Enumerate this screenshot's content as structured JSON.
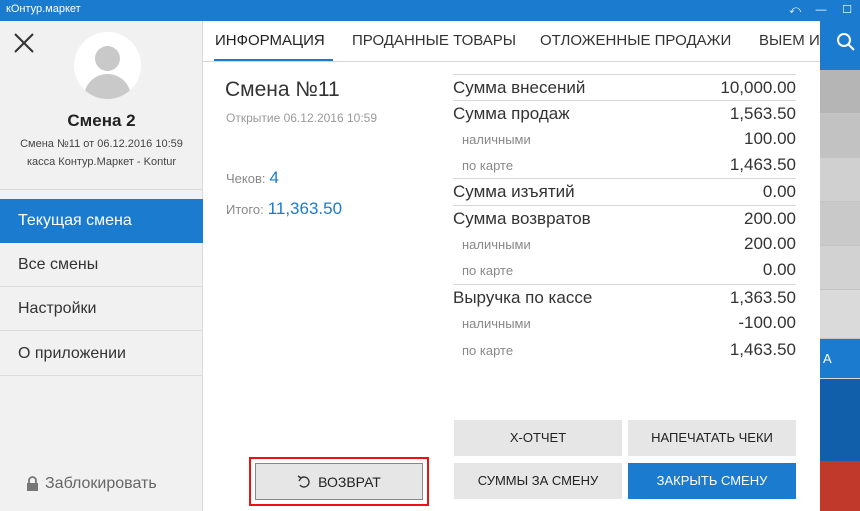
{
  "window": {
    "title": "кОнтур.маркет",
    "btn_back": "⤺",
    "btn_min": "—",
    "btn_max": "☐"
  },
  "sidebar": {
    "user_name": "Смена 2",
    "shift_line": "Смена №11 от 06.12.2016 10:59",
    "cashbox_line": "касса Контур.Маркет - Kontur",
    "menu": [
      {
        "label": "Текущая смена",
        "active": true
      },
      {
        "label": "Все смены",
        "active": false
      },
      {
        "label": "Настройки",
        "active": false
      },
      {
        "label": "О приложении",
        "active": false
      }
    ],
    "lock_label": "Заблокировать"
  },
  "tabs": [
    {
      "label": "ИНФОРМАЦИЯ",
      "active": true
    },
    {
      "label": "ПРОДАННЫЕ ТОВАРЫ",
      "active": false
    },
    {
      "label": "ОТЛОЖЕННЫЕ ПРОДАЖИ",
      "active": false
    },
    {
      "label": "ВЫЕМ И",
      "active": false
    }
  ],
  "shift": {
    "title": "Смена №11",
    "opened": "Открытие 06.12.2016 10:59",
    "checks_label": "Чеков:",
    "checks_value": "4",
    "total_label": "Итого:",
    "total_value": "11,363.50"
  },
  "summary": [
    {
      "label": "Сумма внесений",
      "value": "10,000.00",
      "kind": "main"
    },
    {
      "label": "Сумма продаж",
      "value": "1,563.50",
      "kind": "main"
    },
    {
      "label": "наличными",
      "value": "100.00",
      "kind": "sub"
    },
    {
      "label": "по карте",
      "value": "1,463.50",
      "kind": "sub"
    },
    {
      "label": "Сумма изъятий",
      "value": "0.00",
      "kind": "main"
    },
    {
      "label": "Сумма возвратов",
      "value": "200.00",
      "kind": "main"
    },
    {
      "label": "наличными",
      "value": "200.00",
      "kind": "sub"
    },
    {
      "label": "по карте",
      "value": "0.00",
      "kind": "sub"
    },
    {
      "label": "Выручка по кассе",
      "value": "1,363.50",
      "kind": "main"
    },
    {
      "label": "наличными",
      "value": "-100.00",
      "kind": "sub"
    },
    {
      "label": "по карте",
      "value": "1,463.50",
      "kind": "sub"
    }
  ],
  "actions": {
    "x_report": "X-ОТЧЕТ",
    "print_checks": "НАПЕЧАТАТЬ ЧЕКИ",
    "shift_sums": "СУММЫ ЗА СМЕНУ",
    "close_shift": "ЗАКРЫТЬ СМЕНУ",
    "return": "ВОЗВРАТ"
  },
  "right_strip": {
    "blue_label": "А"
  },
  "colors": {
    "accent": "#1b7bcf",
    "highlight_frame": "#e11111",
    "danger": "#c0392b"
  }
}
